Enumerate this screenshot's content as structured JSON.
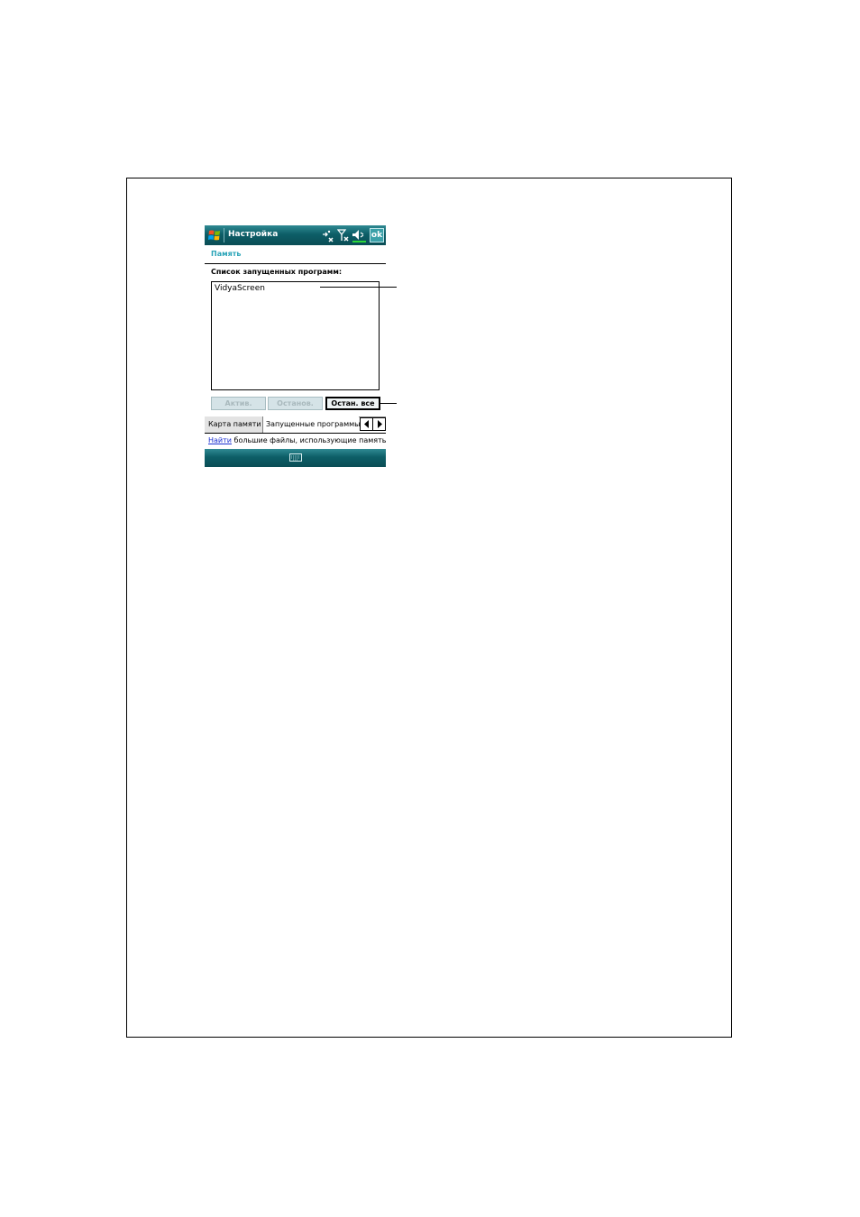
{
  "titlebar": {
    "title": "Настройка",
    "ok_label": "ok"
  },
  "section": {
    "title": "Память"
  },
  "programs": {
    "label": "Список запущенных программ:",
    "items": [
      "VidyaScreen"
    ]
  },
  "buttons": {
    "activate": "Актив.",
    "stop": "Останов.",
    "stop_all": "Остан. все"
  },
  "tabs": {
    "memory_card": "Карта памяти",
    "running_programs": "Запущенные программы"
  },
  "footer": {
    "link": "Найти",
    "text": " большие файлы, использующие память."
  },
  "colors": {
    "titlebar": "#0d5e67",
    "accent": "#2aa4b8",
    "link": "#1a2fd0"
  }
}
